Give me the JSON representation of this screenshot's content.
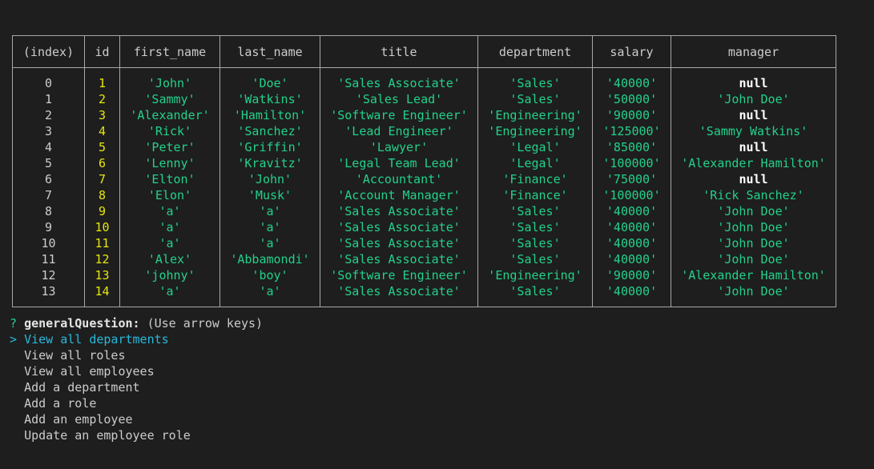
{
  "table": {
    "headers": [
      "(index)",
      "id",
      "first_name",
      "last_name",
      "title",
      "department",
      "salary",
      "manager"
    ],
    "rows": [
      {
        "index": "0",
        "id": "1",
        "first_name": "'John'",
        "last_name": "'Doe'",
        "title": "'Sales Associate'",
        "department": "'Sales'",
        "salary": "'40000'",
        "manager": "null"
      },
      {
        "index": "1",
        "id": "2",
        "first_name": "'Sammy'",
        "last_name": "'Watkins'",
        "title": "'Sales Lead'",
        "department": "'Sales'",
        "salary": "'50000'",
        "manager": "'John Doe'"
      },
      {
        "index": "2",
        "id": "3",
        "first_name": "'Alexander'",
        "last_name": "'Hamilton'",
        "title": "'Software Engineer'",
        "department": "'Engineering'",
        "salary": "'90000'",
        "manager": "null"
      },
      {
        "index": "3",
        "id": "4",
        "first_name": "'Rick'",
        "last_name": "'Sanchez'",
        "title": "'Lead Engineer'",
        "department": "'Engineering'",
        "salary": "'125000'",
        "manager": "'Sammy Watkins'"
      },
      {
        "index": "4",
        "id": "5",
        "first_name": "'Peter'",
        "last_name": "'Griffin'",
        "title": "'Lawyer'",
        "department": "'Legal'",
        "salary": "'85000'",
        "manager": "null"
      },
      {
        "index": "5",
        "id": "6",
        "first_name": "'Lenny'",
        "last_name": "'Kravitz'",
        "title": "'Legal Team Lead'",
        "department": "'Legal'",
        "salary": "'100000'",
        "manager": "'Alexander Hamilton'"
      },
      {
        "index": "6",
        "id": "7",
        "first_name": "'Elton'",
        "last_name": "'John'",
        "title": "'Accountant'",
        "department": "'Finance'",
        "salary": "'75000'",
        "manager": "null"
      },
      {
        "index": "7",
        "id": "8",
        "first_name": "'Elon'",
        "last_name": "'Musk'",
        "title": "'Account Manager'",
        "department": "'Finance'",
        "salary": "'100000'",
        "manager": "'Rick Sanchez'"
      },
      {
        "index": "8",
        "id": "9",
        "first_name": "'a'",
        "last_name": "'a'",
        "title": "'Sales Associate'",
        "department": "'Sales'",
        "salary": "'40000'",
        "manager": "'John Doe'"
      },
      {
        "index": "9",
        "id": "10",
        "first_name": "'a'",
        "last_name": "'a'",
        "title": "'Sales Associate'",
        "department": "'Sales'",
        "salary": "'40000'",
        "manager": "'John Doe'"
      },
      {
        "index": "10",
        "id": "11",
        "first_name": "'a'",
        "last_name": "'a'",
        "title": "'Sales Associate'",
        "department": "'Sales'",
        "salary": "'40000'",
        "manager": "'John Doe'"
      },
      {
        "index": "11",
        "id": "12",
        "first_name": "'Alex'",
        "last_name": "'Abbamondi'",
        "title": "'Sales Associate'",
        "department": "'Sales'",
        "salary": "'40000'",
        "manager": "'John Doe'"
      },
      {
        "index": "12",
        "id": "13",
        "first_name": "'johny'",
        "last_name": "'boy'",
        "title": "'Software Engineer'",
        "department": "'Engineering'",
        "salary": "'90000'",
        "manager": "'Alexander Hamilton'"
      },
      {
        "index": "13",
        "id": "14",
        "first_name": "'a'",
        "last_name": "'a'",
        "title": "'Sales Associate'",
        "department": "'Sales'",
        "salary": "'40000'",
        "manager": "'John Doe'"
      }
    ]
  },
  "prompt": {
    "mark": "?",
    "name": "generalQuestion:",
    "hint": "(Use arrow keys)",
    "pointer": ">",
    "choices": [
      "View all departments",
      "View all roles",
      "View all employees",
      "Add a department",
      "Add a role",
      "Add an employee",
      "Update an employee role"
    ],
    "selected_index": 0
  },
  "colors": {
    "background": "#1e1e1e",
    "text": "#cccccc",
    "string": "#23d18b",
    "number": "#e5e510",
    "null": "#ffffff",
    "selected": "#29b8db",
    "border": "#a8a8a8"
  }
}
